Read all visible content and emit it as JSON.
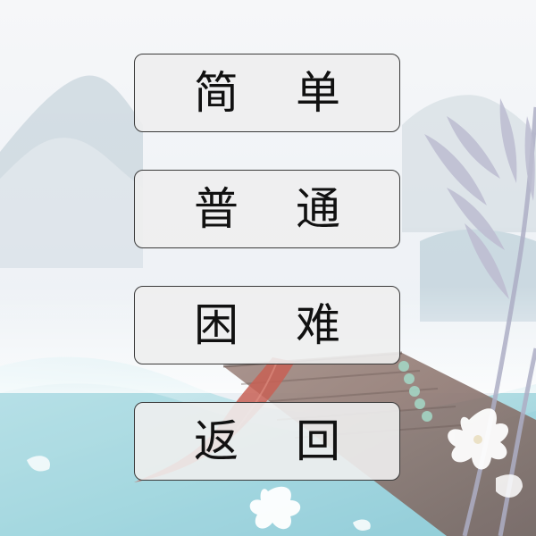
{
  "menu": {
    "items": [
      {
        "label": "简单"
      },
      {
        "label": "普通"
      },
      {
        "label": "困难"
      },
      {
        "label": "返回"
      }
    ]
  },
  "colors": {
    "button_bg": "#eeeeee",
    "button_border": "#3a3a3a",
    "text": "#111111",
    "water": "#9fd3dc",
    "bridge": "#8a6f66",
    "ribbon": "#c4574a",
    "bamboo": "#b9b9cf"
  },
  "icons": {
    "background": "ink-wash-landscape-illustration",
    "flower": "white-flower-icon",
    "bamboo": "bamboo-icon",
    "bridge": "wooden-bridge-icon"
  }
}
